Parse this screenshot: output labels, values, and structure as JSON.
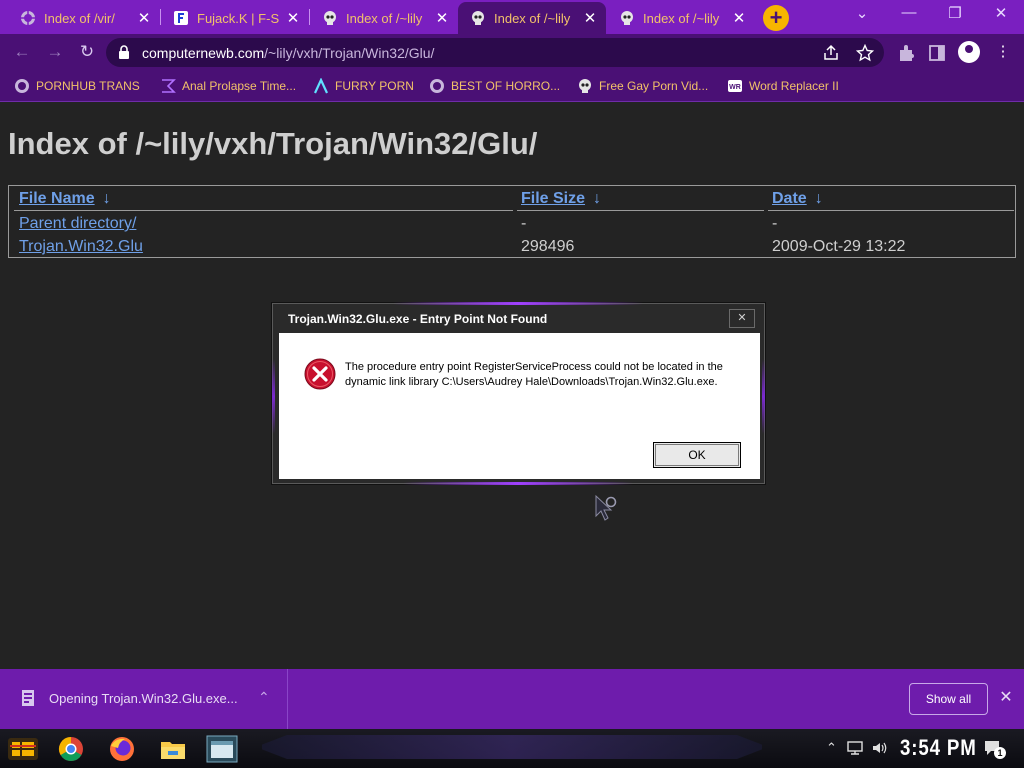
{
  "browser": {
    "tabs": [
      {
        "title": "Index of /vir/",
        "active": false
      },
      {
        "title": "Fujack.K | F-S",
        "active": false
      },
      {
        "title": "Index of /~lily",
        "active": false
      },
      {
        "title": "Index of /~lily",
        "active": true
      },
      {
        "title": "Index of /~lily",
        "active": false
      }
    ],
    "close_glyph": "✕",
    "new_tab_glyph": "+",
    "url_host": "computernewb.com",
    "url_path": "/~lily/vxh/Trojan/Win32/Glu/",
    "window_controls": {
      "dropdown": "⌄",
      "minimize": "—",
      "restore": "❐",
      "close": "✕"
    }
  },
  "bookmarks": [
    {
      "label": "PORNHUB TRANS",
      "icon": "globe-icon"
    },
    {
      "label": "Anal Prolapse Time...",
      "icon": "sigma-icon"
    },
    {
      "label": "FURRY PORN",
      "icon": "lambda-icon"
    },
    {
      "label": "BEST OF HORRO...",
      "icon": "globe-icon"
    },
    {
      "label": "Free Gay Porn Vid...",
      "icon": "skull-icon"
    },
    {
      "label": "Word Replacer II",
      "icon": "wr-icon"
    }
  ],
  "page": {
    "heading": "Index of /~lily/vxh/Trojan/Win32/Glu/",
    "columns": {
      "name": "File Name",
      "size": "File Size",
      "date": "Date",
      "sort_glyph": "↓"
    },
    "rows": [
      {
        "name": "Parent directory/",
        "size": "-",
        "date": "-"
      },
      {
        "name": "Trojan.Win32.Glu",
        "size": "298496",
        "date": "2009-Oct-29 13:22"
      }
    ]
  },
  "dialog": {
    "title": "Trojan.Win32.Glu.exe - Entry Point Not Found",
    "close_glyph": "✕",
    "message": "The procedure entry point RegisterServiceProcess could not be located in the dynamic link library C:\\Users\\Audrey Hale\\Downloads\\Trojan.Win32.Glu.exe.",
    "ok_label": "OK",
    "icon": "error-icon"
  },
  "downloads": {
    "item_text": "Opening Trojan.Win32.Glu.exe...",
    "chevron_glyph": "⌃",
    "show_all_label": "Show all",
    "close_glyph": "✕"
  },
  "taskbar": {
    "clock": "3:54 PM",
    "notification_count": "1",
    "apps": [
      "chrome-icon",
      "firefox-icon",
      "file-explorer-icon",
      "window-icon"
    ]
  },
  "colors": {
    "tab_strip": "#7a1fc0",
    "toolbar": "#4a1075",
    "tab_text": "#f2c26a",
    "link": "#6fa0e8",
    "page_bg": "#232323",
    "download_bar": "#6e1cac"
  }
}
